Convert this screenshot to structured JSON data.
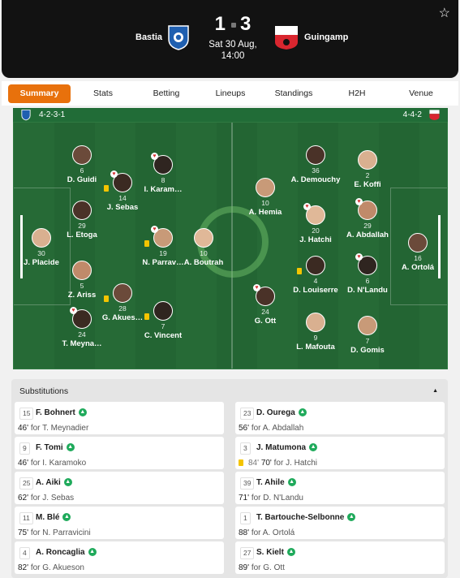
{
  "match": {
    "home_team": "Bastia",
    "away_team": "Guingamp",
    "home_score": "1",
    "away_score": "3",
    "date": "Sat 30 Aug,",
    "time": "14:00"
  },
  "tabs": [
    "Summary",
    "Stats",
    "Betting",
    "Lineups",
    "Standings",
    "H2H",
    "Venue"
  ],
  "active_tab": "Summary",
  "formations": {
    "home": "4-2-3-1",
    "away": "4-4-2"
  },
  "home_players": [
    {
      "num": "6",
      "name": "D. Guidi",
      "heart": false,
      "yellow": false
    },
    {
      "num": "14",
      "name": "J. Sebas",
      "heart": true,
      "yellow": true
    },
    {
      "num": "8",
      "name": "I. Karam…",
      "heart": true,
      "yellow": false
    },
    {
      "num": "29",
      "name": "L. Etoga",
      "heart": false,
      "yellow": false
    },
    {
      "num": "30",
      "name": "J. Placide",
      "heart": false,
      "yellow": false
    },
    {
      "num": "19",
      "name": "N. Parrav…",
      "heart": true,
      "yellow": true
    },
    {
      "num": "10",
      "name": "A. Boutrah",
      "heart": false,
      "yellow": false
    },
    {
      "num": "5",
      "name": "Z. Ariss",
      "heart": false,
      "yellow": false
    },
    {
      "num": "28",
      "name": "G. Akues…",
      "heart": false,
      "yellow": true
    },
    {
      "num": "24",
      "name": "T. Meyna…",
      "heart": true,
      "yellow": false
    },
    {
      "num": "7",
      "name": "C. Vincent",
      "heart": false,
      "yellow": true
    }
  ],
  "away_players": [
    {
      "num": "36",
      "name": "A. Demouchy",
      "heart": false,
      "yellow": false
    },
    {
      "num": "2",
      "name": "E. Koffi",
      "heart": false,
      "yellow": false
    },
    {
      "num": "10",
      "name": "A. Hemia",
      "heart": false,
      "yellow": false
    },
    {
      "num": "20",
      "name": "J. Hatchi",
      "heart": true,
      "yellow": false
    },
    {
      "num": "29",
      "name": "A. Abdallah",
      "heart": true,
      "yellow": false
    },
    {
      "num": "16",
      "name": "A. Ortolá",
      "heart": false,
      "yellow": false
    },
    {
      "num": "4",
      "name": "D. Louiserre",
      "heart": false,
      "yellow": true
    },
    {
      "num": "6",
      "name": "D. N'Landu",
      "heart": true,
      "yellow": false
    },
    {
      "num": "24",
      "name": "G. Ott",
      "heart": true,
      "yellow": false
    },
    {
      "num": "9",
      "name": "L. Mafouta",
      "heart": false,
      "yellow": false
    },
    {
      "num": "7",
      "name": "D. Gomis",
      "heart": false,
      "yellow": false
    }
  ],
  "substitutions": {
    "title": "Substitutions",
    "home": [
      {
        "num": "15",
        "name": "F. Bohnert",
        "minute": "46'",
        "for": "for T. Meynadier"
      },
      {
        "num": "9",
        "name": "F. Tomi",
        "minute": "46'",
        "for": "for I. Karamoko"
      },
      {
        "num": "25",
        "name": "A. Aiki",
        "minute": "62'",
        "for": "for J. Sebas"
      },
      {
        "num": "11",
        "name": "M. Blé",
        "minute": "75'",
        "for": "for N. Parravicini"
      },
      {
        "num": "4",
        "name": "A. Roncaglia",
        "minute": "82'",
        "for": "for G. Akueson"
      }
    ],
    "away": [
      {
        "num": "23",
        "name": "D. Ourega",
        "minute": "56'",
        "for": "for A. Abdallah",
        "card": false
      },
      {
        "num": "3",
        "name": "J. Matumona",
        "minute": "70'",
        "pre": "84'",
        "for": "for J. Hatchi",
        "card": true
      },
      {
        "num": "39",
        "name": "T. Ahile",
        "minute": "71'",
        "for": "for D. N'Landu",
        "card": false
      },
      {
        "num": "1",
        "name": "T. Bartouche-Selbonne",
        "minute": "88'",
        "for": "for A. Ortolá",
        "card": false
      },
      {
        "num": "27",
        "name": "S. Kielt",
        "minute": "89'",
        "for": "for G. Ott",
        "card": false
      }
    ]
  },
  "colors": {
    "accent": "#e8710c",
    "pitch": "#266a36",
    "header": "#121212",
    "sub_arrow": "#1faa5b",
    "yellow": "#f4c400"
  }
}
